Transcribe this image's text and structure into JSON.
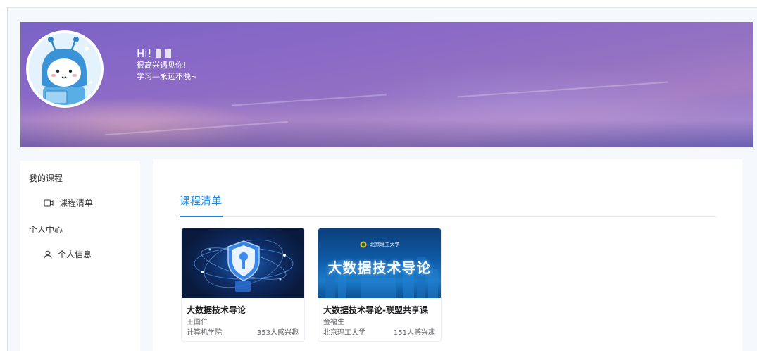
{
  "header": {
    "greeting": "Hi!",
    "welcome_text": "很高兴遇见你!",
    "motto_text": "学习—永远不晚~"
  },
  "sidebar": {
    "sections": [
      {
        "label": "我的课程",
        "items": [
          {
            "label": "课程清单",
            "icon": "video-camera-icon"
          }
        ]
      },
      {
        "label": "个人中心",
        "items": [
          {
            "label": "个人信息",
            "icon": "user-icon"
          }
        ]
      }
    ]
  },
  "main": {
    "title": "课程清单",
    "courses": [
      {
        "title": "大数据技术导论",
        "teacher": "王国仁",
        "school": "计算机学院",
        "interest": "353人感兴趣",
        "thumbnail_icon": "security-shield-icon"
      },
      {
        "title": "大数据技术导论-联盟共享课",
        "teacher": "金福生",
        "school": "北京理工大学",
        "interest": "151人感兴趣",
        "thumbnail_title": "大数据技术导论",
        "thumbnail_logo_text": "北京理工大学"
      }
    ]
  },
  "colors": {
    "accent": "#1e88e5",
    "banner_start": "#7a63c6",
    "banner_end": "#7f74cf"
  }
}
